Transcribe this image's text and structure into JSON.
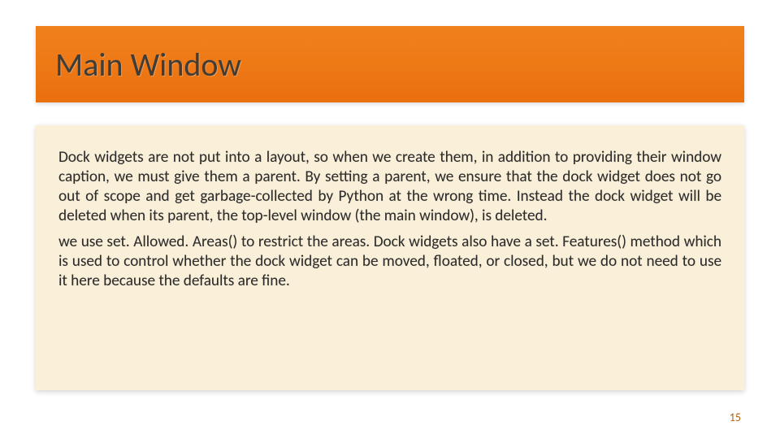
{
  "title": "Main Window",
  "paragraph1": "Dock widgets are not put into a layout, so when we create them, in addition to providing their window caption, we must give them a parent. By setting a parent, we ensure that the dock widget does not go out of scope and get garbage-collected by Python at the wrong time. Instead the dock widget will be deleted when its parent, the top-level window (the main window), is deleted.",
  "paragraph2": "we use set. Allowed. Areas() to restrict the areas. Dock widgets also have a set. Features() method which is used to control whether the dock widget can be moved, floated, or closed, but we do not need to use it here because the defaults are fine.",
  "page_number": "15"
}
